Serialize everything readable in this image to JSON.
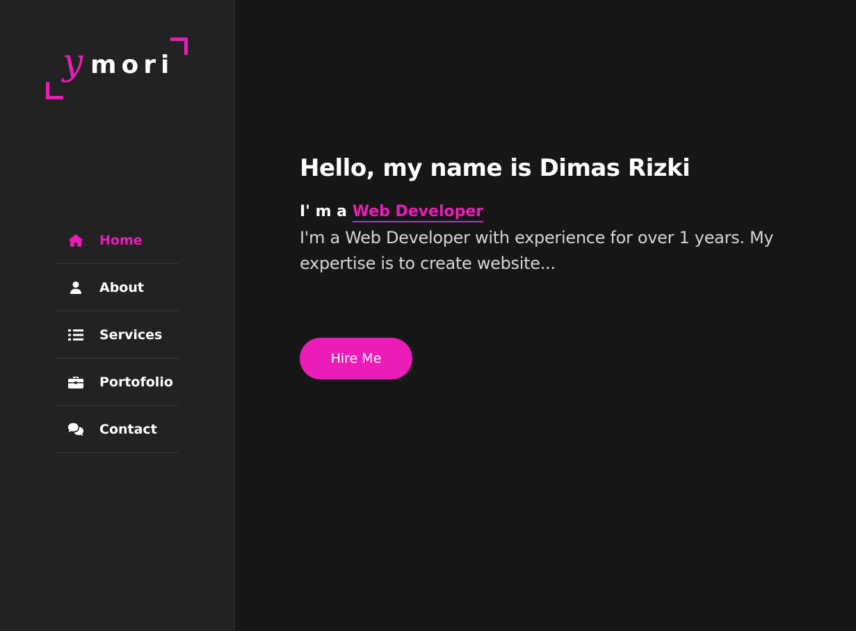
{
  "logo": {
    "initial": "y",
    "rest": "mori"
  },
  "nav": {
    "items": [
      {
        "label": "Home",
        "icon": "home-icon",
        "active": true
      },
      {
        "label": "About",
        "icon": "user-icon",
        "active": false
      },
      {
        "label": "Services",
        "icon": "list-icon",
        "active": false
      },
      {
        "label": "Portofolio",
        "icon": "briefcase-icon",
        "active": false
      },
      {
        "label": "Contact",
        "icon": "comments-icon",
        "active": false
      }
    ]
  },
  "hero": {
    "title": "Hello, my name is Dimas Rizki",
    "role_prefix": "I' m a",
    "role": "Web Developer",
    "description": "I'm a Web Developer with experience for over 1 years. My expertise is to create website...",
    "button_label": "Hire Me"
  },
  "colors": {
    "accent": "#ec1cb8",
    "sidebar_bg": "#222222",
    "main_bg": "#161616",
    "text": "#ffffff",
    "muted_text": "#d6d6d6"
  }
}
